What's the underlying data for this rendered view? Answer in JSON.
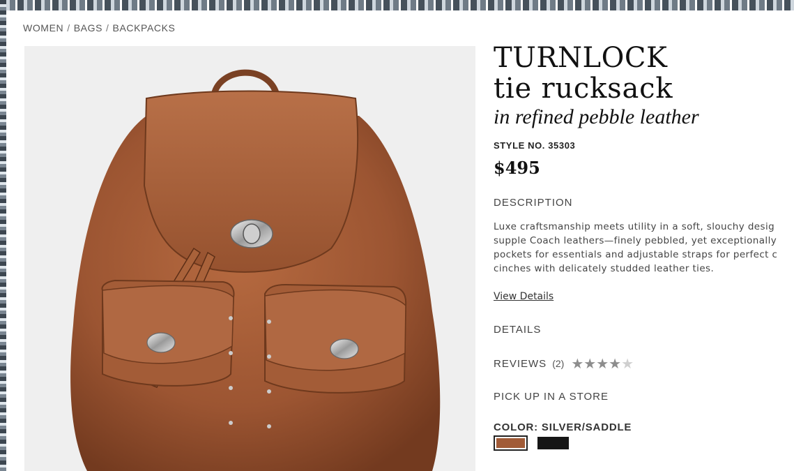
{
  "breadcrumb": {
    "items": [
      "WOMEN",
      "BAGS",
      "BACKPACKS"
    ],
    "separator": "/"
  },
  "product": {
    "title_line1": "TURNLOCK",
    "title_line2": "tie rucksack",
    "subtitle": "in refined pebble leather",
    "style_no": "STYLE NO. 35303",
    "price": "$495",
    "image_icon": "backpack-icon"
  },
  "description": {
    "heading": "DESCRIPTION",
    "lines": [
      "Luxe craftsmanship meets utility in a soft, slouchy desig",
      "supple Coach leathers—finely pebbled, yet exceptionally",
      "pockets for essentials and adjustable straps for perfect c",
      "cinches with delicately studded leather ties."
    ],
    "link": "View Details"
  },
  "details": {
    "heading": "DETAILS"
  },
  "reviews": {
    "heading": "REVIEWS",
    "count": "(2)",
    "rating": 4,
    "max": 5
  },
  "pickup": {
    "heading": "PICK UP IN A STORE"
  },
  "color": {
    "label": "COLOR: SILVER/SADDLE",
    "swatches": [
      {
        "name": "saddle",
        "hex": "#a15b37",
        "selected": true
      },
      {
        "name": "black",
        "hex": "#161616",
        "selected": false
      }
    ]
  },
  "colors": {
    "leather": "#a15b37",
    "background": "#efefef"
  }
}
